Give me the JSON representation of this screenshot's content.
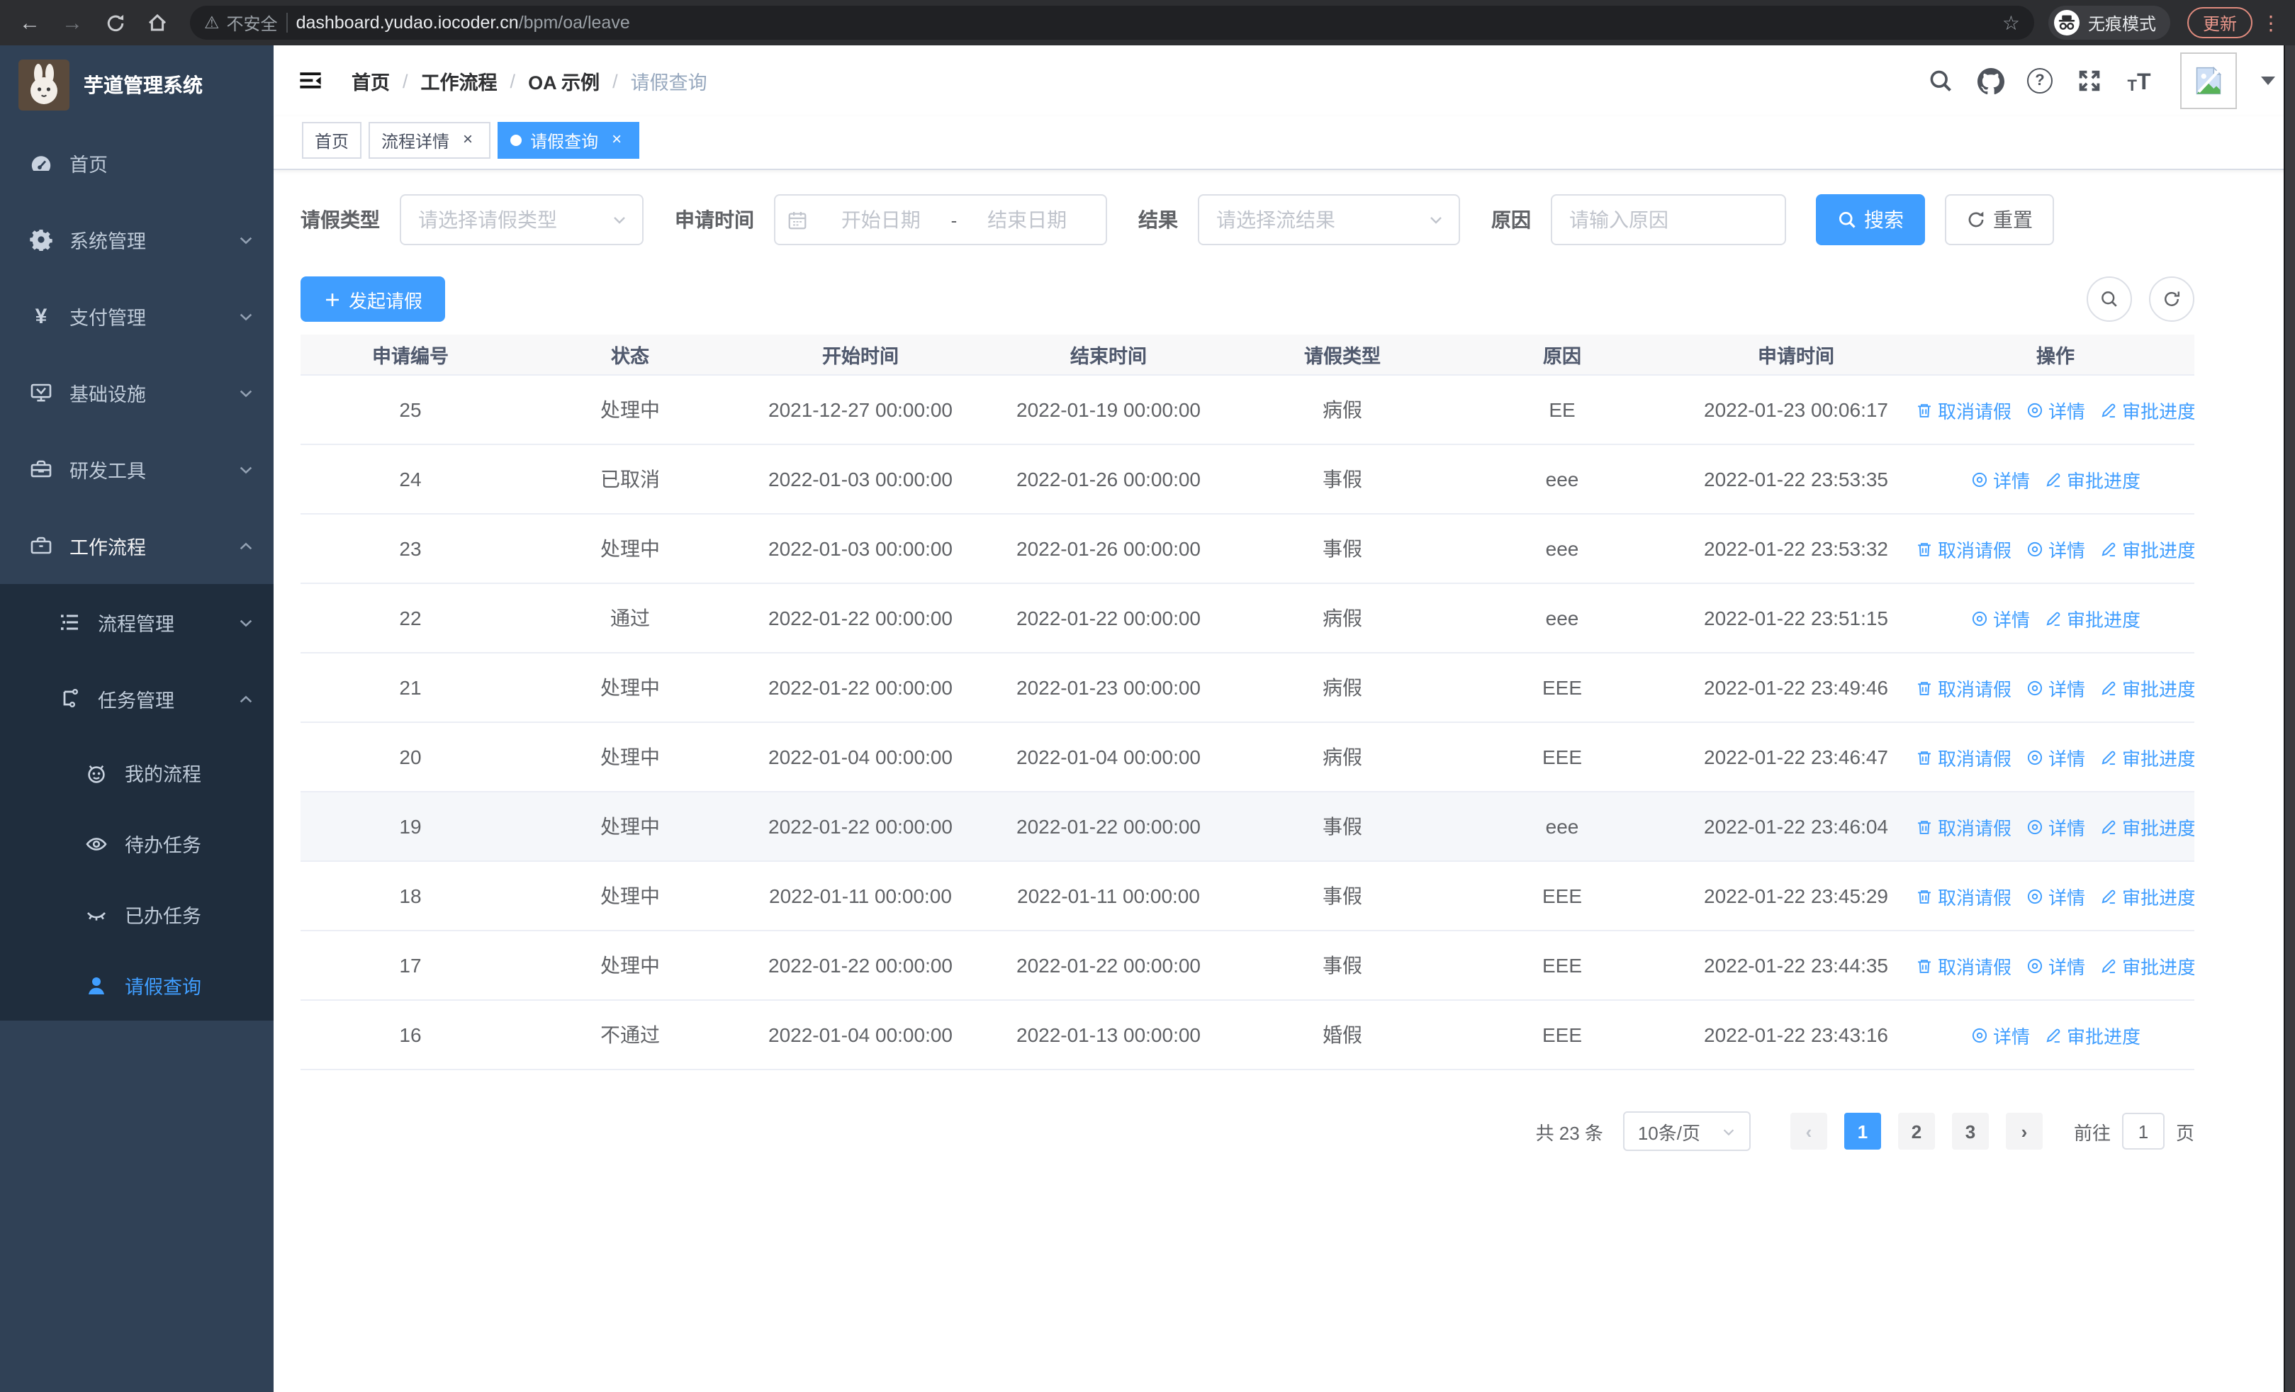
{
  "browser": {
    "security_label": "不安全",
    "url_host": "dashboard.yudao.iocoder.cn",
    "url_path": "/bpm/oa/leave",
    "incognito_label": "无痕模式",
    "update_label": "更新"
  },
  "glyphs": {
    "back": "←",
    "forward": "→",
    "star": "☆",
    "warning": "⚠",
    "menu_dots": "⋮",
    "separator": "/",
    "range_dash": "-",
    "close": "×",
    "question": "?",
    "font_small": "T",
    "font_large": "T",
    "yen": "¥",
    "prev": "‹",
    "next": "›"
  },
  "sidebar": {
    "app_title": "芋道管理系统",
    "menu": [
      {
        "label": "首页"
      },
      {
        "label": "系统管理"
      },
      {
        "label": "支付管理"
      },
      {
        "label": "基础设施"
      },
      {
        "label": "研发工具"
      },
      {
        "label": "工作流程"
      }
    ],
    "flow_submenu": [
      {
        "label": "流程管理"
      },
      {
        "label": "任务管理"
      }
    ],
    "task_submenu": [
      {
        "label": "我的流程"
      },
      {
        "label": "待办任务"
      },
      {
        "label": "已办任务"
      },
      {
        "label": "请假查询"
      }
    ]
  },
  "header": {
    "breadcrumb": [
      "首页",
      "工作流程",
      "OA 示例",
      "请假查询"
    ]
  },
  "tabs": [
    {
      "label": "首页"
    },
    {
      "label": "流程详情"
    },
    {
      "label": "请假查询"
    }
  ],
  "filters": {
    "type_label": "请假类型",
    "type_placeholder": "请选择请假类型",
    "time_label": "申请时间",
    "start_placeholder": "开始日期",
    "end_placeholder": "结束日期",
    "result_label": "结果",
    "result_placeholder": "请选择流结果",
    "reason_label": "原因",
    "reason_placeholder": "请输入原因",
    "search_label": "搜索",
    "reset_label": "重置"
  },
  "toolbar": {
    "create_label": "发起请假"
  },
  "table": {
    "columns": [
      "申请编号",
      "状态",
      "开始时间",
      "结束时间",
      "请假类型",
      "原因",
      "申请时间",
      "操作"
    ],
    "action_labels": {
      "cancel": "取消请假",
      "detail": "详情",
      "progress": "审批进度"
    },
    "rows": [
      {
        "id": "25",
        "status": "处理中",
        "start": "2021-12-27 00:00:00",
        "end": "2022-01-19 00:00:00",
        "type": "病假",
        "reason": "EE",
        "applied": "2022-01-23 00:06:17",
        "cancellable": true,
        "highlighted": false
      },
      {
        "id": "24",
        "status": "已取消",
        "start": "2022-01-03 00:00:00",
        "end": "2022-01-26 00:00:00",
        "type": "事假",
        "reason": "eee",
        "applied": "2022-01-22 23:53:35",
        "cancellable": false,
        "highlighted": false
      },
      {
        "id": "23",
        "status": "处理中",
        "start": "2022-01-03 00:00:00",
        "end": "2022-01-26 00:00:00",
        "type": "事假",
        "reason": "eee",
        "applied": "2022-01-22 23:53:32",
        "cancellable": true,
        "highlighted": false
      },
      {
        "id": "22",
        "status": "通过",
        "start": "2022-01-22 00:00:00",
        "end": "2022-01-22 00:00:00",
        "type": "病假",
        "reason": "eee",
        "applied": "2022-01-22 23:51:15",
        "cancellable": false,
        "highlighted": false
      },
      {
        "id": "21",
        "status": "处理中",
        "start": "2022-01-22 00:00:00",
        "end": "2022-01-23 00:00:00",
        "type": "病假",
        "reason": "EEE",
        "applied": "2022-01-22 23:49:46",
        "cancellable": true,
        "highlighted": false
      },
      {
        "id": "20",
        "status": "处理中",
        "start": "2022-01-04 00:00:00",
        "end": "2022-01-04 00:00:00",
        "type": "病假",
        "reason": "EEE",
        "applied": "2022-01-22 23:46:47",
        "cancellable": true,
        "highlighted": false
      },
      {
        "id": "19",
        "status": "处理中",
        "start": "2022-01-22 00:00:00",
        "end": "2022-01-22 00:00:00",
        "type": "事假",
        "reason": "eee",
        "applied": "2022-01-22 23:46:04",
        "cancellable": true,
        "highlighted": true
      },
      {
        "id": "18",
        "status": "处理中",
        "start": "2022-01-11 00:00:00",
        "end": "2022-01-11 00:00:00",
        "type": "事假",
        "reason": "EEE",
        "applied": "2022-01-22 23:45:29",
        "cancellable": true,
        "highlighted": false
      },
      {
        "id": "17",
        "status": "处理中",
        "start": "2022-01-22 00:00:00",
        "end": "2022-01-22 00:00:00",
        "type": "事假",
        "reason": "EEE",
        "applied": "2022-01-22 23:44:35",
        "cancellable": true,
        "highlighted": false
      },
      {
        "id": "16",
        "status": "不通过",
        "start": "2022-01-04 00:00:00",
        "end": "2022-01-13 00:00:00",
        "type": "婚假",
        "reason": "EEE",
        "applied": "2022-01-22 23:43:16",
        "cancellable": false,
        "highlighted": false
      }
    ]
  },
  "pagination": {
    "total_label": "共 23 条",
    "size_label": "10条/页",
    "pages": [
      "1",
      "2",
      "3"
    ],
    "active_page": "1",
    "goto_label": "前往",
    "goto_value": "1",
    "unit_label": "页"
  },
  "colors": {
    "primary": "#409eff",
    "sidebar_bg": "#304156",
    "sidebar_submenu_bg": "#1f2d3d",
    "update_accent": "#e8968a"
  }
}
